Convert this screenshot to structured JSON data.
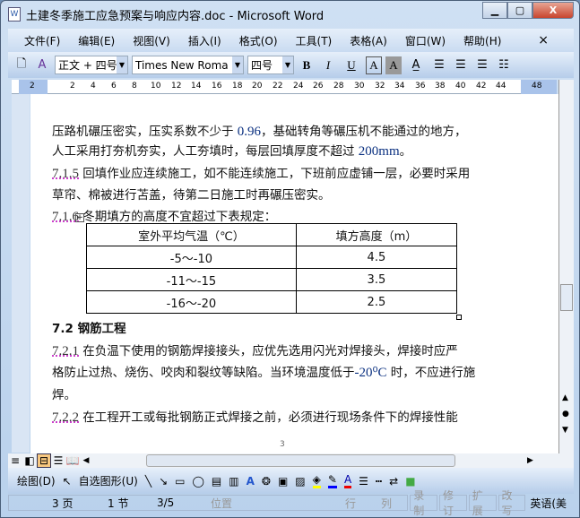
{
  "window": {
    "title": "土建冬季施工应急预案与响应内容.doc - Microsoft Word",
    "app_icon": "word-icon"
  },
  "menu": [
    "文件(F)",
    "编辑(E)",
    "视图(V)",
    "插入(I)",
    "格式(O)",
    "工具(T)",
    "表格(A)",
    "窗口(W)",
    "帮助(H)"
  ],
  "menu_close": "×",
  "toolbar": {
    "style": "正文 + 四号",
    "font": "Times New Roma",
    "size": "四号",
    "bold": "B",
    "italic": "I",
    "underline": "U",
    "char_border": "A",
    "char_shade": "A"
  },
  "ruler": [
    "2",
    "2",
    "4",
    "6",
    "8",
    "10",
    "12",
    "14",
    "16",
    "18",
    "20",
    "22",
    "24",
    "26",
    "28",
    "30",
    "32",
    "34",
    "36",
    "38",
    "40",
    "42",
    "44",
    "48"
  ],
  "doc": {
    "p1a": "压路机碾压密实，压实系数不少于 ",
    "p1b": "0.96",
    "p1c": "，基础转角等碾压机不能通过的地方，",
    "p2a": "人工采用打夯机夯实，人工夯填时，每层回填厚度不超过 ",
    "p2b": "200mm",
    "p2c": "。",
    "p3n": "7.1.5",
    "p3": " 回填作业应连续施工，如不能连续施工，下班前应虚铺一层，必要时采用",
    "p4": "草帘、棉被进行苫盖，待第二日施工时再碾压密实。",
    "p5n": "7.1.6",
    "p5": "  冬期填方的高度不宜超过下表规定：",
    "table": {
      "headers": [
        "室外平均气温（℃）",
        "填方高度（m）"
      ],
      "rows": [
        [
          "-5～-10",
          "4.5"
        ],
        [
          "-11～-15",
          "3.5"
        ],
        [
          "-16～-20",
          "2.5"
        ]
      ]
    },
    "h72": "7.2   钢筋工程",
    "p6n": "7.2.1",
    "p6": "   在负温下使用的钢筋焊接接头，应优先选用闪光对焊接头，焊接时应严",
    "p7a": "格防止过热、烧伤、咬肉和裂纹等缺陷。当环境温度低于",
    "p7b": "-20⁰C",
    "p7c": " 时，不应进行施",
    "p8": "焊。",
    "p9n": "7.2.2",
    "p9": "   在工程开工或每批钢筋正式焊接之前，必须进行现场条件下的焊接性能",
    "page_number": "3"
  },
  "draw": {
    "draw_label": "绘图(D)",
    "autoshape_label": "自选图形(U)"
  },
  "status": {
    "page": "3 页",
    "section": "1 节",
    "pages": "3/5",
    "position": "位置",
    "line": "行",
    "col": "列",
    "rec": "录制",
    "trk": "修订",
    "ext": "扩展",
    "ovr": "改写",
    "lang": "英语(美"
  }
}
